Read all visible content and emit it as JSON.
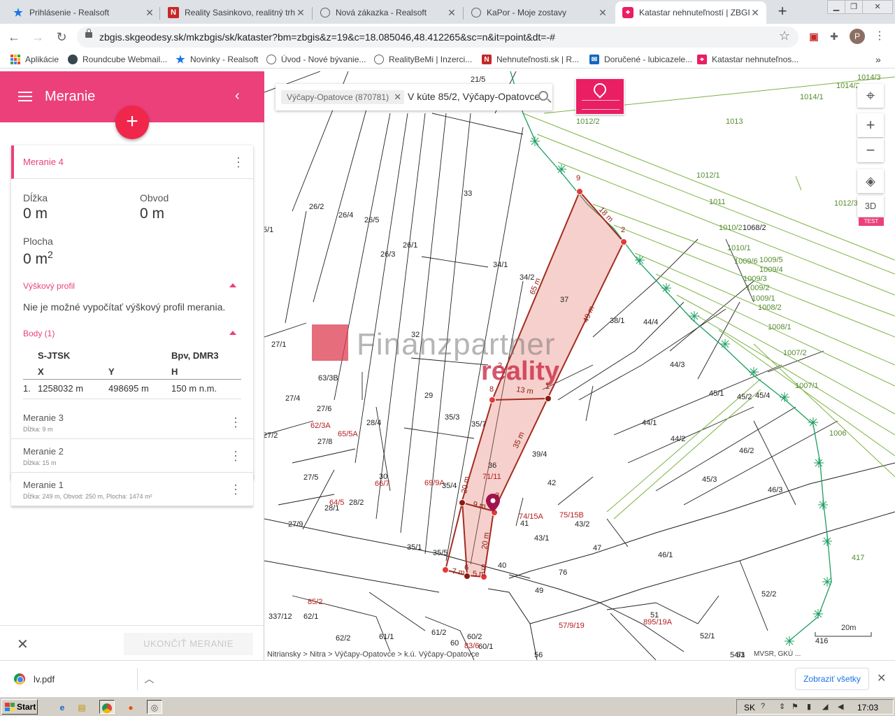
{
  "browser": {
    "tabs": [
      {
        "title": "Prihlásenie - Realsoft",
        "icon": "star-icon",
        "active": false
      },
      {
        "title": "Reality Sasinkovo, realitný trh n",
        "icon": "nehnutelnosti-n-icon",
        "active": false
      },
      {
        "title": "Nová zákazka - Realsoft",
        "icon": "globe-icon",
        "active": false
      },
      {
        "title": "KaPor - Moje zostavy",
        "icon": "globe-icon",
        "active": false
      },
      {
        "title": "Katastar nehnuteľností | ZBGIS",
        "icon": "zbgis-pin-icon",
        "active": true
      }
    ],
    "url": "zbgis.skgeodesy.sk/mkzbgis/sk/kataster?bm=zbgis&z=19&c=18.085046,48.412265&sc=n&it=point&dt=-#",
    "profile_initial": "P",
    "bookmarks": [
      {
        "label": "Aplikácie",
        "icon": "apps-grid-icon"
      },
      {
        "label": "Roundcube Webmail...",
        "icon": "roundcube-icon"
      },
      {
        "label": "Novinky - Realsoft",
        "icon": "star-icon"
      },
      {
        "label": "Úvod - Nové bývanie...",
        "icon": "globe-icon"
      },
      {
        "label": "RealityBeMi | Inzerci...",
        "icon": "globe-icon"
      },
      {
        "label": "Nehnuteľnosti.sk | R...",
        "icon": "nehnutelnosti-n-icon"
      },
      {
        "label": "Doručené - lubicazele...",
        "icon": "mail-icon"
      },
      {
        "label": "Katastar nehnuteľnos...",
        "icon": "zbgis-pin-icon"
      }
    ],
    "bookmarks_more": "»"
  },
  "panel": {
    "title": "Meranie",
    "fab_label": "+",
    "active_measurement": {
      "name": "Meranie 4",
      "length_label": "Dĺžka",
      "length_value": "0 m",
      "perimeter_label": "Obvod",
      "perimeter_value": "0 m",
      "area_label": "Plocha",
      "area_value": "0 m",
      "area_sup": "2",
      "elevation_section": "Výškový profil",
      "elevation_message": "Nie je možné vypočítať výškový profil merania.",
      "points_section": "Body (1)",
      "points_table": {
        "crs": "S-JTSK",
        "height_model": "Bpv, DMR3",
        "col_x": "X",
        "col_y": "Y",
        "col_h": "H",
        "rows": [
          {
            "index": "1.",
            "x": "1258032 m",
            "y": "498695 m",
            "h": "150 m n.m."
          }
        ]
      }
    },
    "measurements": [
      {
        "name": "Meranie 3",
        "desc": "Dĺžka: 9 m"
      },
      {
        "name": "Meranie 2",
        "desc": "Dĺžka: 15 m"
      },
      {
        "name": "Meranie 1",
        "desc": "Dĺžka: 249 m, Obvod: 250 m, Plocha: 1474 m²"
      }
    ],
    "finish_label": "UKONČIŤ MERANIE"
  },
  "map": {
    "search_chip": "Výčapy-Opatovce (870781)",
    "search_text": "V kúte 85/2, Výčapy-Opatovce",
    "buttons": [
      "locate-icon",
      "zoom-in-icon",
      "zoom-out-icon",
      "layers-icon"
    ],
    "btn_3d": "3D",
    "test_badge": "TEST",
    "watermark_brand": "Finanzpartner",
    "watermark_sub": "reality",
    "breadcrumb": "Nitriansky  >  Nitra  >  Výčapy-Opatovce  >  k.ú. Výčapy-Opatovce",
    "attribution": "MVSR, GKÚ ...",
    "scale_label": "20m",
    "parcel_labels": [
      "21/5",
      "33",
      "26/2",
      "26/4",
      "26/5",
      "26/1",
      "26/3",
      "5/1",
      "34/1",
      "34/2",
      "37",
      "38/1",
      "32",
      "27/1",
      "63/3B",
      "29",
      "35/3",
      "35/7",
      "27/4",
      "27/6",
      "62/3A",
      "65/5A",
      "28/4",
      "27/8",
      "27/2",
      "27/5",
      "64/5",
      "28/1",
      "28/2",
      "30",
      "66/7",
      "69/9A",
      "35/4",
      "36",
      "71/11",
      "39/4",
      "42",
      "44/4",
      "44/3",
      "44/1",
      "44/2",
      "45/1",
      "45/2",
      "45/3",
      "45/4",
      "46/2",
      "46/3",
      "27/9",
      "35/1",
      "35/5",
      "40",
      "41",
      "74/15A",
      "75/15B",
      "43/2",
      "43/1",
      "47",
      "46/1",
      "49",
      "76",
      "57/9/19",
      "51",
      "895/19A",
      "52/2",
      "52/1",
      "54/1",
      "53",
      "56",
      "85/2",
      "337/12",
      "62/1",
      "62/2",
      "61/1",
      "61/2",
      "60",
      "60/2",
      "83/6",
      "60/1",
      "1012/2",
      "1013",
      "1014/1",
      "1014/2",
      "1014/3",
      "1012/1",
      "1011",
      "1012/3",
      "1010/2",
      "1068/2",
      "1010/1",
      "1009/5",
      "1009/6",
      "1009/4",
      "1009/3",
      "1009/2",
      "1009/1",
      "1008/2",
      "1008/1",
      "1007/2",
      "1007/1",
      "1006",
      "417",
      "416"
    ],
    "vertex_labels": [
      "9",
      "2",
      "8",
      "1",
      "2",
      "3",
      "6",
      "5"
    ],
    "segment_labels": [
      "18 m",
      "65 m",
      "49 m",
      "13 m",
      "35 m",
      "20 m",
      "9 m",
      "20 m",
      "7 m",
      "5 m"
    ]
  },
  "downloads": {
    "file": "lv.pdf",
    "show_all": "Zobraziť všetky"
  },
  "taskbar": {
    "start": "Start",
    "lang": "SK",
    "clock": "17:03"
  }
}
